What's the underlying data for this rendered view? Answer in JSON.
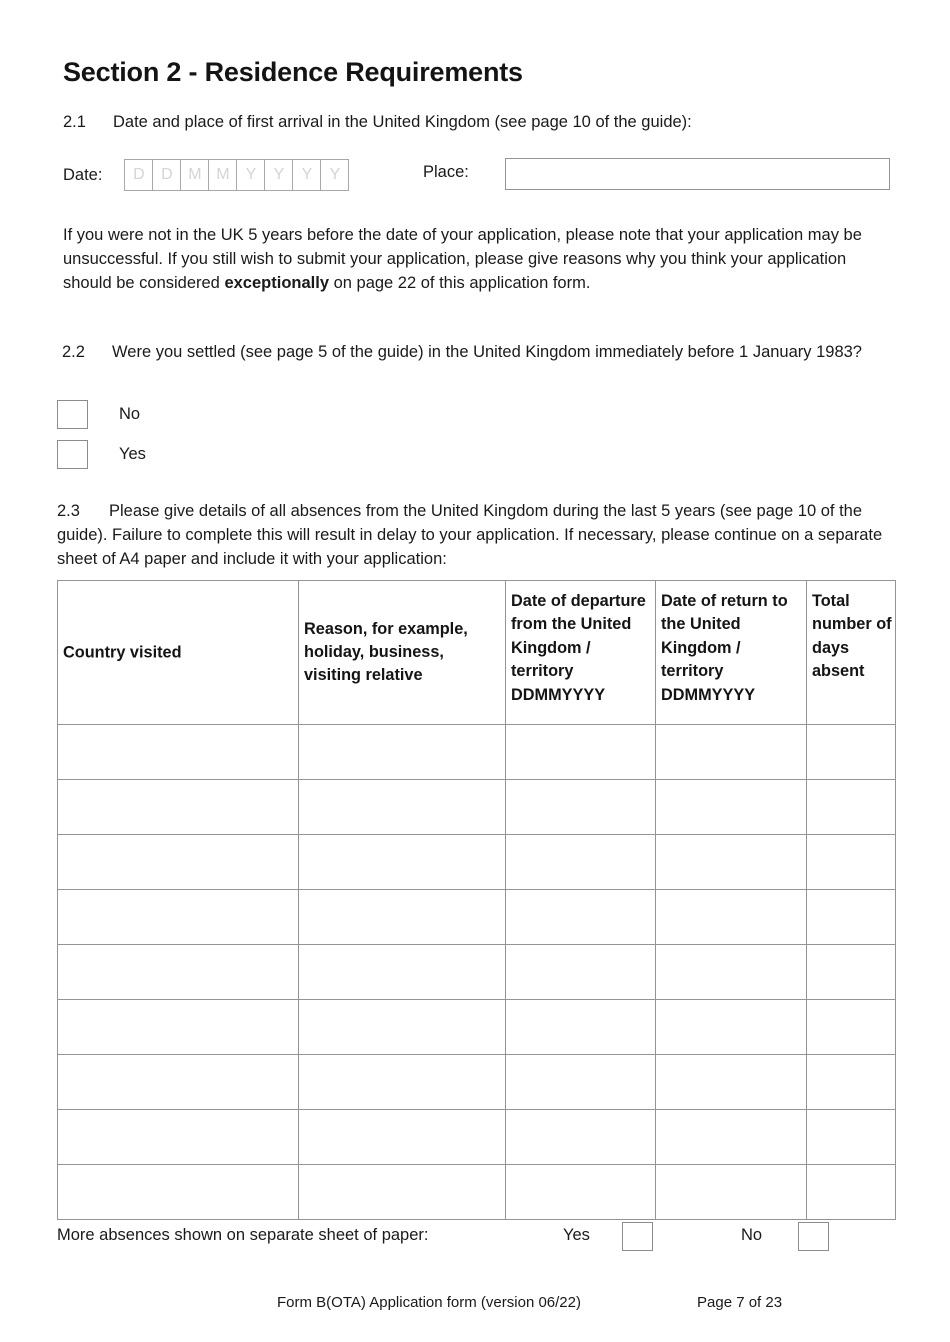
{
  "section": {
    "title": "Section 2 - Residence Requirements"
  },
  "q21": {
    "number": "2.1",
    "text": "Date and place of first arrival in the United Kingdom (see page 10 of the guide):",
    "date_label": "Date:",
    "date_placeholder_cells": [
      "D",
      "D",
      "M",
      "M",
      "Y",
      "Y",
      "Y",
      "Y"
    ],
    "place_label": "Place:",
    "place_value": ""
  },
  "note": {
    "part1": "If you were not in the UK 5 years before the date of your application, please note that your application may be unsuccessful. If you still wish to submit your application, please give reasons why you think your application should be considered ",
    "emphasis": "exceptionally",
    "part2": " on page 22 of this application form."
  },
  "q22": {
    "number": "2.2",
    "text": "Were you settled (see page 5 of the guide) in the United Kingdom immediately before 1 January 1983?",
    "options": [
      {
        "label": "No",
        "checked": false
      },
      {
        "label": "Yes",
        "checked": false
      }
    ]
  },
  "q23": {
    "number": "2.3",
    "text": "Please give details of all absences from the United Kingdom during the last 5 years (see page 10 of the guide). Failure to complete this will result in delay to your application. If necessary, please continue on a separate sheet of A4 paper and include it with your application:"
  },
  "absence_table": {
    "headers": [
      "Country visited",
      "Reason, for example, holiday, business, visiting relative",
      "Date of departure from the United Kingdom / territory DDMMYYYY",
      "Date of return to the United Kingdom / territory DDMMYYYY",
      "Total number of days absent"
    ],
    "rows": [
      [
        "",
        "",
        "",
        "",
        ""
      ],
      [
        "",
        "",
        "",
        "",
        ""
      ],
      [
        "",
        "",
        "",
        "",
        ""
      ],
      [
        "",
        "",
        "",
        "",
        ""
      ],
      [
        "",
        "",
        "",
        "",
        ""
      ],
      [
        "",
        "",
        "",
        "",
        ""
      ],
      [
        "",
        "",
        "",
        "",
        ""
      ],
      [
        "",
        "",
        "",
        "",
        ""
      ],
      [
        "",
        "",
        "",
        "",
        ""
      ]
    ]
  },
  "more_absences": {
    "label": "More absences shown on separate sheet of paper:",
    "yes_label": "Yes",
    "no_label": "No",
    "yes_checked": false,
    "no_checked": false
  },
  "footer": {
    "form_text": "Form B(OTA) Application form (version 06/22)",
    "page_text": "Page 7 of 23"
  },
  "colors": {
    "text": "#1a1a1a",
    "border": "#949494",
    "placeholder": "#d5d5d5",
    "background": "#ffffff"
  }
}
